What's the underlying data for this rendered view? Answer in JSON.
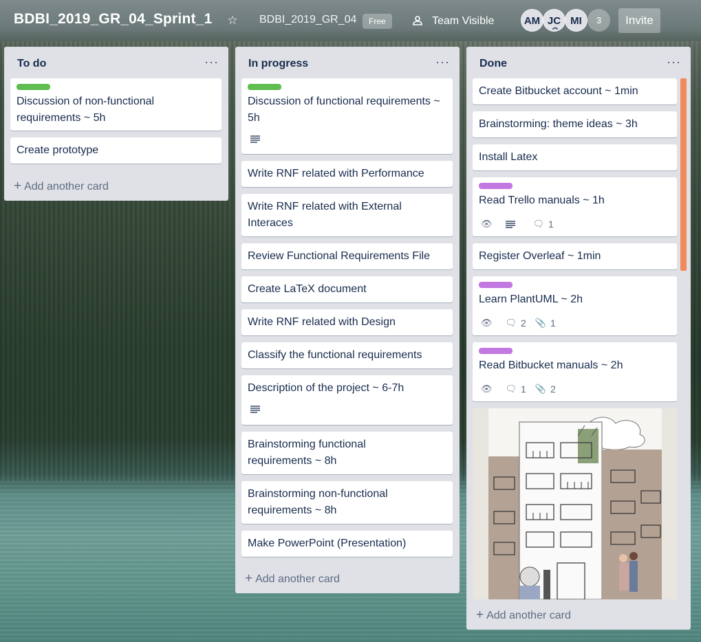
{
  "header": {
    "board_title": "BDBI_2019_GR_04_Sprint_1",
    "team_name": "BDBI_2019_GR_04",
    "plan_badge": "Free",
    "visibility": "Team Visible",
    "members": [
      "AM",
      "JC",
      "MI"
    ],
    "more_members": "3",
    "invite": "Invite"
  },
  "lists": [
    {
      "title": "To do",
      "cards": [
        {
          "text": "Discussion of non-functional requirements ~ 5h",
          "label": "green"
        },
        {
          "text": "Create prototype"
        }
      ],
      "add_card": "Add another card"
    },
    {
      "title": "In progress",
      "cards": [
        {
          "text": "Discussion of functional requirements ~ 5h",
          "label": "green",
          "has_description": true
        },
        {
          "text": "Write RNF related with Performance"
        },
        {
          "text": "Write RNF related with External Interaces"
        },
        {
          "text": "Review Functional Requirements File"
        },
        {
          "text": "Create LaTeX document"
        },
        {
          "text": "Write RNF related with Design"
        },
        {
          "text": "Classify the functional requirements"
        },
        {
          "text": "Description of the project ~ 6-7h",
          "has_description": true
        },
        {
          "text": "Brainstorming functional requirements ~ 8h"
        },
        {
          "text": "Brainstorming non-functional requirements ~ 8h"
        },
        {
          "text": "Make PowerPoint (Presentation)"
        }
      ],
      "add_card": "Add another card"
    },
    {
      "title": "Done",
      "cards": [
        {
          "text": "Create Bitbucket account ~ 1min"
        },
        {
          "text": "Brainstorming: theme ideas ~ 3h"
        },
        {
          "text": "Install Latex"
        },
        {
          "text": "Read Trello manuals ~ 1h",
          "label": "purple",
          "comments": "1"
        },
        {
          "text": "Register Overleaf ~ 1min"
        },
        {
          "text": "Learn PlantUML ~ 2h",
          "label": "purple",
          "comments": "2",
          "attachments": "1"
        },
        {
          "text": "Read Bitbucket manuals ~ 2h",
          "label": "purple",
          "comments": "1",
          "attachments": "2"
        }
      ],
      "add_card": "Add another card"
    }
  ],
  "icons": {
    "star": "star-icon",
    "team": "team-icon",
    "list_menu": "ellipsis-icon",
    "watch": "eye-icon",
    "description": "description-icon",
    "comment": "comment-icon",
    "attachment": "paperclip-icon",
    "add": "plus-icon"
  },
  "colors": {
    "label_green": "#61bd4f",
    "label_purple": "#c377e0",
    "list_bg": "#dfe1e6",
    "scrollbar": "#f08a5a"
  }
}
